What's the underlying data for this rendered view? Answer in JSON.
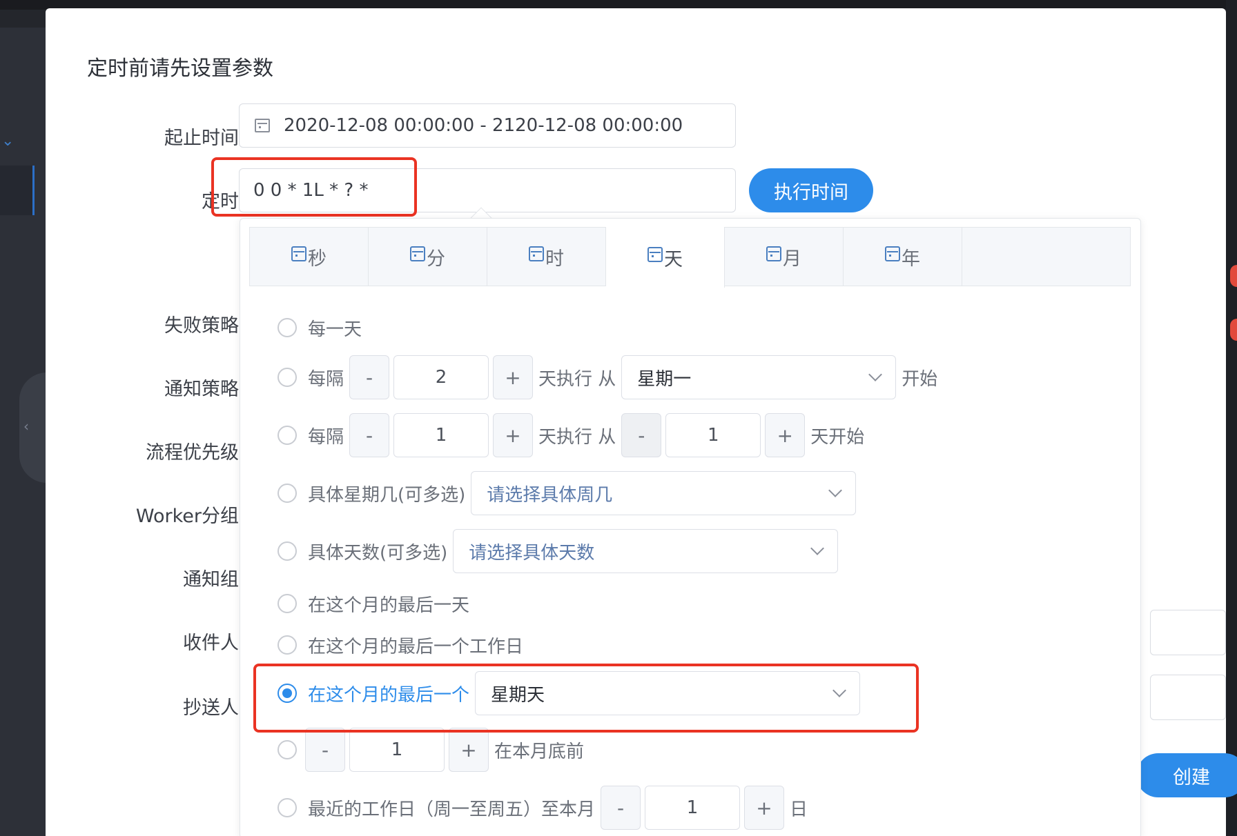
{
  "modal": {
    "title": "定时前请先设置参数",
    "create_button": "创建",
    "exec_button": "执行时间"
  },
  "form": {
    "date_range_label": "起止时间",
    "date_range_value": "2020-12-08 00:00:00 - 2120-12-08 00:00:00",
    "timer_label": "定时",
    "timer_value": "0 0 * 1L * ? *",
    "failure_label": "失败策略",
    "notify_label": "通知策略",
    "priority_label": "流程优先级",
    "worker_label": "Worker分组",
    "notify_group_label": "通知组",
    "recipient_label": "收件人",
    "cc_label": "抄送人"
  },
  "cron": {
    "tabs": [
      {
        "label": "秒"
      },
      {
        "label": "分"
      },
      {
        "label": "时"
      },
      {
        "label": "天"
      },
      {
        "label": "月"
      },
      {
        "label": "年"
      }
    ],
    "active_tab": "天",
    "options": {
      "every_day": "每一天",
      "interval_prefix": "每隔",
      "interval_mid": "天执行 从",
      "interval_suffix_week": "开始",
      "interval_suffix_day": "天开始",
      "interval1_value": "2",
      "interval1_week": "星期一",
      "interval2_value": "1",
      "interval2_start": "1",
      "specific_week_label": "具体星期几(可多选)",
      "specific_week_placeholder": "请选择具体周几",
      "specific_day_label": "具体天数(可多选)",
      "specific_day_placeholder": "请选择具体天数",
      "last_day": "在这个月的最后一天",
      "last_workday": "在这个月的最后一个工作日",
      "last_week_label": "在这个月的最后一个",
      "last_week_value": "星期天",
      "before_end_value": "1",
      "before_end_suffix": "在本月底前",
      "nearest_workday_label": "最近的工作日（周一至周五）至本月",
      "nearest_workday_value": "1",
      "nearest_workday_suffix": "日"
    },
    "minus": "-",
    "plus": "+"
  },
  "colors": {
    "accent": "#2d8cea",
    "highlight": "#ea3323"
  }
}
